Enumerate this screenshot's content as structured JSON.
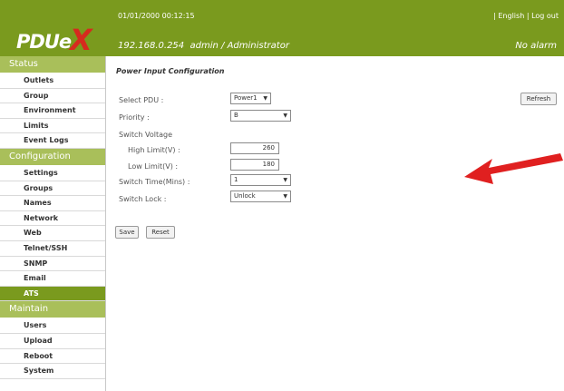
{
  "header": {
    "logo_text": "PDUe",
    "logo_x": "X",
    "datetime": "01/01/2000 00:12:15",
    "lang_link": "English",
    "logout_link": "Log out",
    "separator": "|",
    "ip": "192.168.0.254",
    "user": "admin / Administrator",
    "alarm": "No alarm"
  },
  "sidebar": {
    "sections": [
      {
        "title": "Status",
        "items": [
          "Outlets",
          "Group",
          "Environment",
          "Limits",
          "Event Logs"
        ]
      },
      {
        "title": "Configuration",
        "items": [
          "Settings",
          "Groups",
          "Names",
          "Network",
          "Web",
          "Telnet/SSH",
          "SNMP",
          "Email",
          "ATS"
        ]
      },
      {
        "title": "Maintain",
        "items": [
          "Users",
          "Upload",
          "Reboot",
          "System"
        ]
      }
    ],
    "active": "ATS"
  },
  "main": {
    "title": "Power Input Configuration",
    "select_pdu_label": "Select PDU :",
    "select_pdu_value": "Power1",
    "refresh_label": "Refresh",
    "priority_label": "Priority :",
    "priority_value": "B",
    "switch_voltage_label": "Switch Voltage",
    "high_limit_label": "High Limit(V) :",
    "high_limit_value": "260",
    "low_limit_label": "Low Limit(V) :",
    "low_limit_value": "180",
    "switch_time_label": "Switch Time(Mins) :",
    "switch_time_value": "1",
    "switch_lock_label": "Switch Lock :",
    "switch_lock_value": "Unlock",
    "save_label": "Save",
    "reset_label": "Reset"
  },
  "colors": {
    "header_green": "#7a9a1e",
    "section_green": "#a9bf5a",
    "logo_x_red": "#d62a1e",
    "arrow_red": "#e02020"
  }
}
